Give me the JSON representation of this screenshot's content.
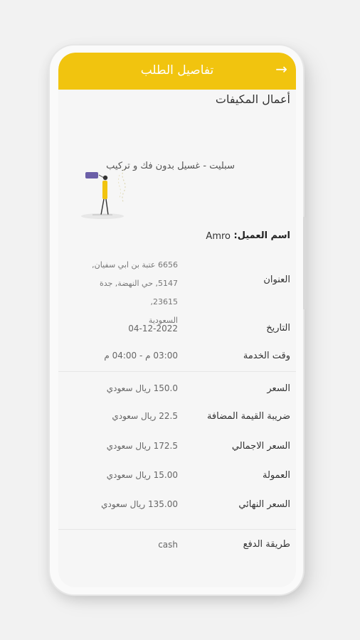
{
  "header": {
    "title": "تفاصيل الطلب",
    "back_icon": "→"
  },
  "order": {
    "category": "أعمال المكيفات",
    "service": "سبليت - غسيل بدون فك و تركيب",
    "customer_label": "اسم العميل:",
    "customer_name": "Amro",
    "address_label": "العنوان",
    "address_lines": [
      "6656 عتبة بن ابي سفيان,",
      "5147, حي النهضة, جدة 23615,",
      "السعودية"
    ],
    "date_label": "التاريخ",
    "date_value": "04-12-2022",
    "time_label": "وقت الخدمة",
    "time_value": "03:00 م - 04:00 م"
  },
  "pricing": {
    "price_label": "السعر",
    "price_value": "150.0 ريال سعودي",
    "vat_label": "ضريبة القيمة المضافة",
    "vat_value": "22.5 ريال سعودي",
    "total_label": "السعر الاجمالي",
    "total_value": "172.5 ريال سعودي",
    "commission_label": "العمولة",
    "commission_value": "15.00 ريال سعودي",
    "final_label": "السعر النهائي",
    "final_value": "135.00 ريال سعودي"
  },
  "payment": {
    "label": "طريقة الدفع",
    "value": "cash"
  },
  "colors": {
    "accent": "#f1c40f"
  }
}
